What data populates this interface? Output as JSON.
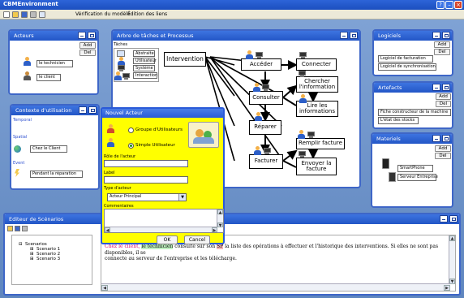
{
  "app": {
    "title": "CBMEnvironment"
  },
  "menubar": {
    "menu1": "Vérification du modèle",
    "menu2": "Édition des liens"
  },
  "acteurs": {
    "title": "Acteurs",
    "add": "Add",
    "del": "Del",
    "items": [
      "le technicien",
      "le client"
    ]
  },
  "contexte": {
    "title": "Contexte d'utilisation",
    "temporal": "Temporal",
    "spatial": "Spatial",
    "event": "Event",
    "client_field": "Chez le Client",
    "repair_field": "Pendant la réparation"
  },
  "arbre": {
    "title": "Arbre de tâches et Processus",
    "legend_title": "Tâches",
    "legend": [
      "Abstraite",
      "Utilisateur",
      "Système",
      "Interaction"
    ],
    "nodes": {
      "intervention": "Intervention",
      "acceder": "Accéder",
      "connecter": "Connecter",
      "chercher": "Chercher l'information",
      "consulter": "Consulter",
      "lire": "Lire les informations",
      "reparer": "Réparer",
      "remplir": "Remplir facture",
      "facturer": "Facturer",
      "envoyer": "Envoyer la facture"
    }
  },
  "logiciels": {
    "title": "Logiciels",
    "add": "Add",
    "del": "Del",
    "items": [
      "Logiciel de facturation",
      "Logiciel de synchronisation"
    ]
  },
  "artefacts": {
    "title": "Artefacts",
    "add": "Add",
    "del": "Del",
    "items": [
      "Fiche constructeur de la machine",
      "L'état des stocks"
    ]
  },
  "materiels": {
    "title": "Materiels",
    "add": "Add",
    "del": "Del",
    "items": [
      "SmartPhone",
      "Serveur Entreprise"
    ]
  },
  "dialog": {
    "title": "Nouvel Acteur",
    "radio_group": "Groupe d'Utilisateurs",
    "radio_simple": "Simple Utilisateur",
    "role_label": "Rôle de l'acteur",
    "label_label": "Label",
    "type_label": "Type d'acteur",
    "type_value": "Acteur Principal",
    "comments_label": "Commentaires",
    "ok": "OK",
    "cancel": "Cancel"
  },
  "editeur": {
    "title": "Editeur de Scénarios",
    "tree_root": "Scenarios",
    "tree_items": [
      "Scenario 1",
      "Scenario 2",
      "Scenario 3"
    ],
    "text_client": "Chez le client,",
    "text_tech": "le technicien",
    "text_mid": " consulte sur son ",
    "text_sp": "SP",
    "text_rest1": " la liste des opérations à effectuer et l'historique des interventions. Si elles ne sont pas disponibles, il se",
    "text_rest2": "connecte au serveur de l'entreprise et les télécharge."
  }
}
